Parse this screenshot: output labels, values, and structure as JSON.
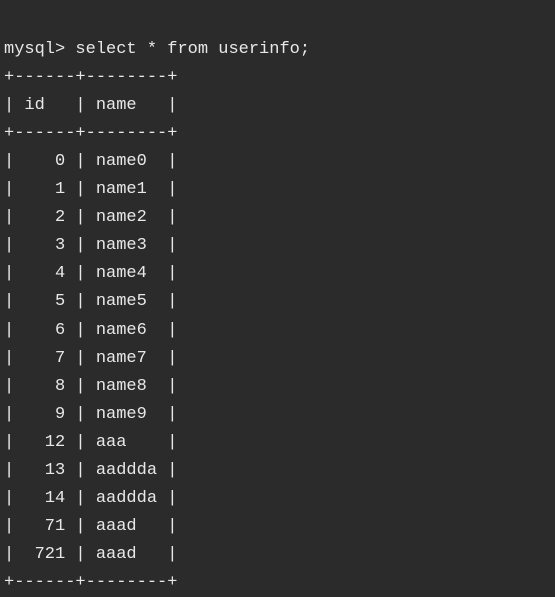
{
  "prompt": "mysql> ",
  "query": "select * from userinfo;",
  "table": {
    "border_top": "+------+--------+",
    "border_mid": "+------+--------+",
    "border_bottom": "+------+--------+",
    "header_col1": "id",
    "header_col2": "name",
    "rows": [
      {
        "id": "0",
        "name": "name0"
      },
      {
        "id": "1",
        "name": "name1"
      },
      {
        "id": "2",
        "name": "name2"
      },
      {
        "id": "3",
        "name": "name3"
      },
      {
        "id": "4",
        "name": "name4"
      },
      {
        "id": "5",
        "name": "name5"
      },
      {
        "id": "6",
        "name": "name6"
      },
      {
        "id": "7",
        "name": "name7"
      },
      {
        "id": "8",
        "name": "name8"
      },
      {
        "id": "9",
        "name": "name9"
      },
      {
        "id": "12",
        "name": "aaa"
      },
      {
        "id": "13",
        "name": "aaddda"
      },
      {
        "id": "14",
        "name": "aaddda"
      },
      {
        "id": "71",
        "name": "aaad"
      },
      {
        "id": "721",
        "name": "aaad"
      }
    ]
  }
}
